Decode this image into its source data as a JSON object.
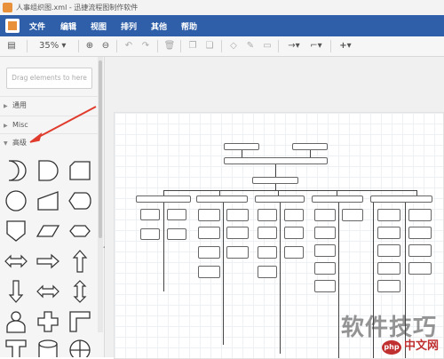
{
  "window": {
    "title": "人事组织图.xml - 迅捷流程图制作软件"
  },
  "menu": {
    "items": [
      "文件",
      "编辑",
      "视图",
      "排列",
      "其他",
      "帮助"
    ]
  },
  "toolbar": {
    "zoom": "35%"
  },
  "sidebar": {
    "search_placeholder": "Drag elements to here",
    "sections": [
      {
        "label": "通用",
        "expanded": false
      },
      {
        "label": "Misc",
        "expanded": false
      },
      {
        "label": "高级",
        "expanded": true
      }
    ],
    "shapes": [
      "delay",
      "data-storage",
      "card",
      "connector",
      "manual-input",
      "display",
      "off-page-reference",
      "parallelogram",
      "hexagon",
      "left-right-arrow",
      "right-arrow",
      "up-arrow",
      "down-arrow",
      "bidirectional-arrow",
      "up-down-arrow",
      "actor",
      "cross",
      "corner",
      "tee",
      "cylinder",
      "summing-junction"
    ]
  },
  "annotation": {
    "arrow_color": "#e03c2d"
  },
  "watermark": {
    "text": "软件技巧",
    "site": "中文网",
    "badge": "php"
  },
  "colors": {
    "menubar": "#2f5fa8",
    "accent": "#e8913a"
  }
}
